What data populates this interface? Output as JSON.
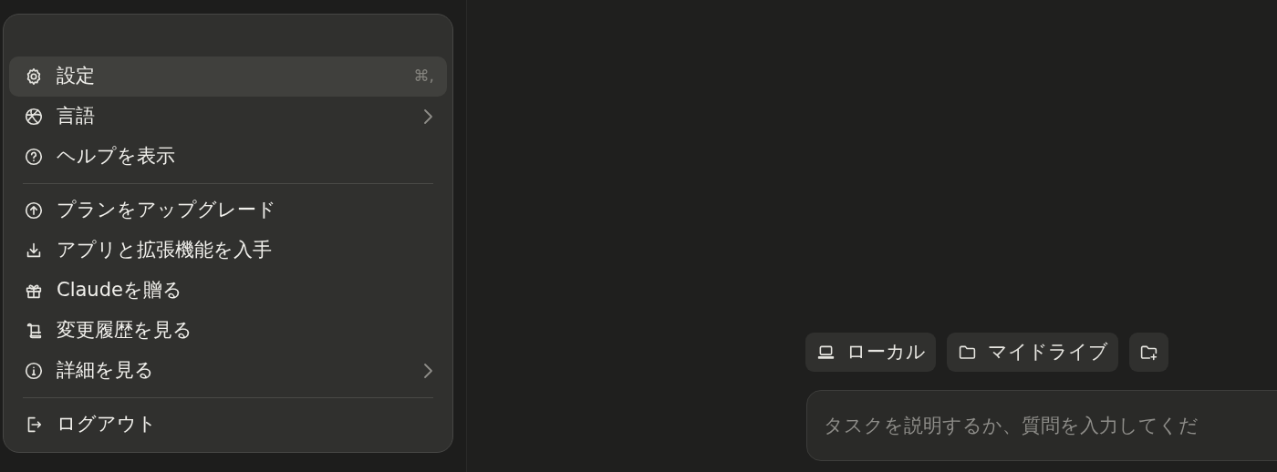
{
  "menu": {
    "groups": [
      [
        {
          "label": "設定",
          "shortcut": "⌘,",
          "has_submenu": false,
          "selected": true
        },
        {
          "label": "言語",
          "has_submenu": true,
          "selected": false
        },
        {
          "label": "ヘルプを表示",
          "has_submenu": false,
          "selected": false
        }
      ],
      [
        {
          "label": "プランをアップグレード",
          "has_submenu": false,
          "selected": false
        },
        {
          "label": "アプリと拡張機能を入手",
          "has_submenu": false,
          "selected": false
        },
        {
          "label": "Claudeを贈る",
          "has_submenu": false,
          "selected": false
        },
        {
          "label": "変更履歴を見る",
          "has_submenu": false,
          "selected": false
        },
        {
          "label": "詳細を見る",
          "has_submenu": true,
          "selected": false
        }
      ],
      [
        {
          "label": "ログアウト",
          "has_submenu": false,
          "selected": false
        }
      ]
    ]
  },
  "location_buttons": [
    {
      "kind": "local",
      "label": "ローカル"
    },
    {
      "kind": "folder",
      "label": "マイドライブ"
    },
    {
      "kind": "add_folder"
    }
  ],
  "prompt": {
    "placeholder": "タスクを説明するか、質問を入力してくだ"
  }
}
